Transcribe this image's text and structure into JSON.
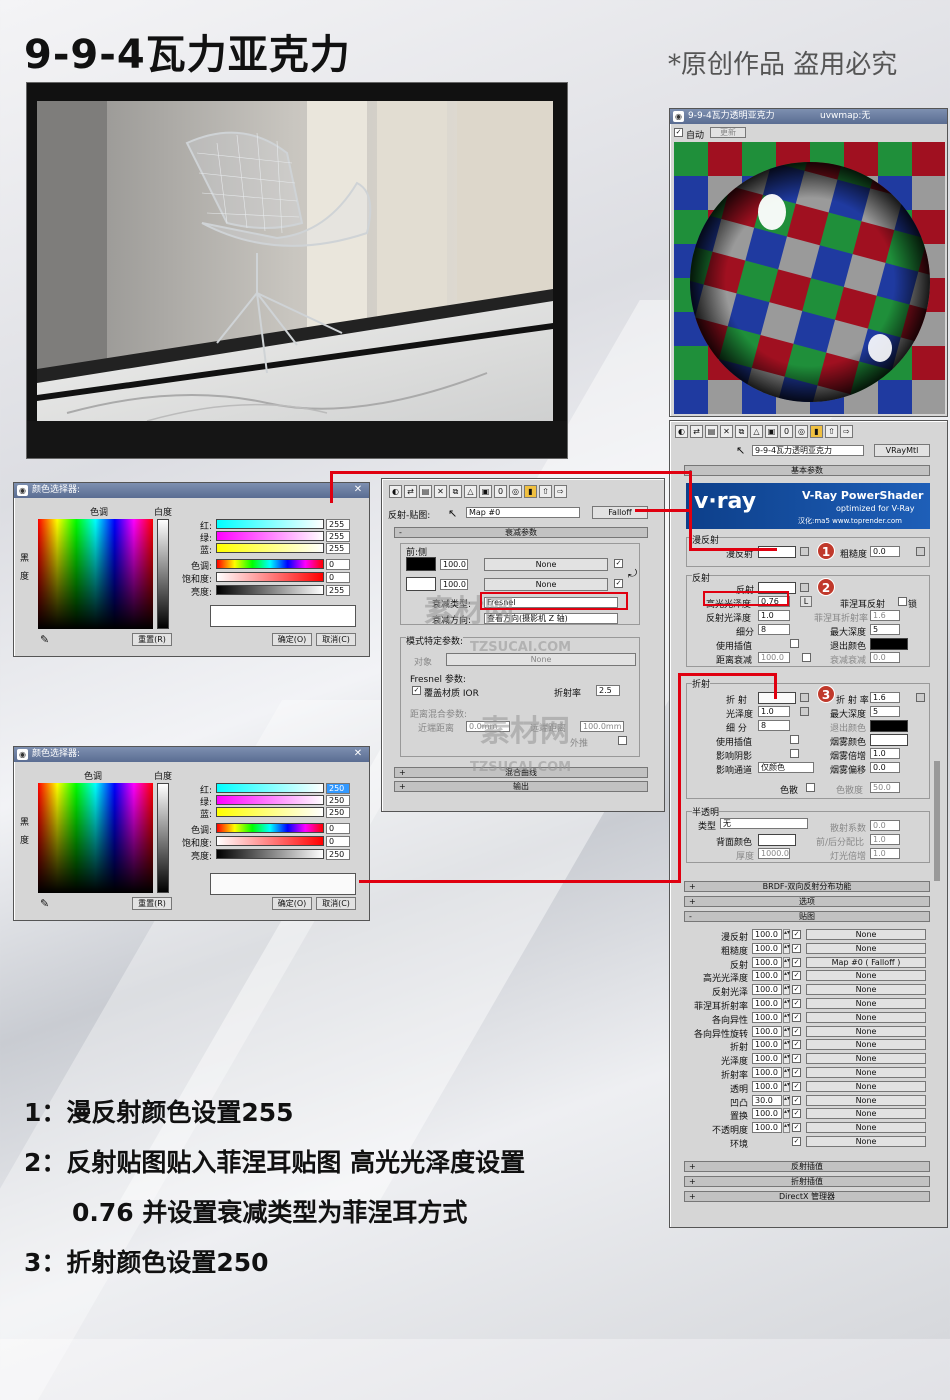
{
  "title": "9-9-4瓦力亚克力",
  "copyright": "*原创作品 盗用必究",
  "watermark": {
    "line1": "素材网",
    "line2": "TZSUCAI.COM"
  },
  "colorpicker1": {
    "title": "颜色选择器:",
    "hue": "色调",
    "white": "白度",
    "black": "黑",
    "degree": "度",
    "labels": [
      "红:",
      "绿:",
      "蓝:",
      "色调:",
      "饱和度:",
      "亮度:"
    ],
    "values": [
      "255",
      "255",
      "255",
      "0",
      "0",
      "255"
    ],
    "reset": "重置(R)",
    "ok": "确定(O)",
    "cancel": "取消(C)"
  },
  "colorpicker2": {
    "title": "颜色选择器:",
    "hue": "色调",
    "white": "白度",
    "black": "黑",
    "degree": "度",
    "labels": [
      "红:",
      "绿:",
      "蓝:",
      "色调:",
      "饱和度:",
      "亮度:"
    ],
    "values": [
      "250",
      "250",
      "250",
      "0",
      "0",
      "250"
    ],
    "reset": "重置(R)",
    "ok": "确定(O)",
    "cancel": "取消(C)"
  },
  "falloff": {
    "map_label": "反射-贴图:",
    "map_name": "Map #0",
    "map_type": "Falloff",
    "rollout": "衰减参数",
    "front_side": "前:侧",
    "v1": "100.0",
    "v2": "100.0",
    "none": "None",
    "falloff_type_label": "衰减类型:",
    "falloff_type": "Fresnel",
    "falloff_dir_label": "衰减方向:",
    "falloff_dir": "查看方向(摄影机 Z 轴)",
    "mode_params": "模式特定参数:",
    "object": "对象",
    "object_none": "None",
    "fresnel_params": "Fresnel 参数:",
    "override_ior": "覆盖材质 IOR",
    "ior_label": "折射率",
    "ior": "2.5",
    "dist_blend": "距离混合参数:",
    "near_label": "近端距离",
    "near": "0.0mm",
    "far_label": "远端距离",
    "far": "100.0mm",
    "extrapolate": "外推",
    "mix_curve": "混合曲线",
    "output": "输出"
  },
  "material": {
    "title": "9-9-4瓦力透明亚克力",
    "title2": "uvwmap:无",
    "auto": "自动",
    "update": "更新",
    "mat_name": "9-9-4瓦力透明亚克力",
    "mat_type": "VRayMtl",
    "basic_params": "基本参数",
    "vray_logo": "v·ray",
    "banner_title": "V-Ray PowerShader",
    "banner_sub": "optimized for V-Ray",
    "banner_credit": "汉化:ma5  www.toprender.com",
    "diffuse_grp": "漫反射",
    "diffuse": "漫反射",
    "roughness": "粗糙度",
    "roughness_val": "0.0",
    "reflect_grp": "反射",
    "reflect": "反射",
    "hilight": "高光光泽度",
    "hilight_val": "0.76",
    "lock": "L",
    "fresnel": "菲涅耳反射",
    "lock2": "锁",
    "refl_gloss": "反射光泽度",
    "refl_gloss_val": "1.0",
    "fresnel_ior": "菲涅耳折射率",
    "fresnel_ior_val": "1.6",
    "subdivs": "细分",
    "subdivs_val": "8",
    "max_depth": "最大深度",
    "max_depth_val": "5",
    "interp": "使用插值",
    "exit_color": "退出颜色",
    "dim_dist": "距离衰减",
    "dim_dist_val": "100.0",
    "dim_falloff": "衰减衰减",
    "dim_falloff_val": "0.0",
    "refract_grp": "折射",
    "refract": "折  射",
    "ior": "折 射 率",
    "ior_val": "1.6",
    "gloss": "光泽度",
    "gloss_val": "1.0",
    "max_depth2_val": "5",
    "subdivs2": "细  分",
    "subdivs2_val": "8",
    "exit_color2": "退出颜色",
    "interp2": "使用插值",
    "fog_color": "烟雾颜色",
    "shadows": "影响阴影",
    "fog_mult": "烟雾倍增",
    "fog_mult_val": "1.0",
    "affect_ch": "影响通道",
    "affect_ch_val": "仅颜色",
    "fog_bias": "烟雾偏移",
    "fog_bias_val": "0.0",
    "dispersion": "色散",
    "abbe": "色散度",
    "abbe_val": "50.0",
    "translucent_grp": "半透明",
    "type": "类型",
    "type_val": "无",
    "scatter": "散射系数",
    "scatter_val": "0.0",
    "back_color": "背面颜色",
    "fb": "前/后分配比",
    "fb_val": "1.0",
    "thickness": "厚度",
    "thickness_val": "1000.0",
    "light_mult": "灯光倍增",
    "light_mult_val": "1.0",
    "brdf": "BRDF-双向反射分布功能",
    "options": "选项",
    "maps": "贴图",
    "refl_interp": "反射插值",
    "refr_interp": "折射插值",
    "directx": "DirectX 管理器",
    "map_rows": [
      {
        "name": "漫反射",
        "val": "100.0",
        "map": "None"
      },
      {
        "name": "粗糙度",
        "val": "100.0",
        "map": "None"
      },
      {
        "name": "反射",
        "val": "100.0",
        "map": "Map #0  ( Falloff )"
      },
      {
        "name": "高光光泽度",
        "val": "100.0",
        "map": "None"
      },
      {
        "name": "反射光泽",
        "val": "100.0",
        "map": "None"
      },
      {
        "name": "菲涅耳折射率",
        "val": "100.0",
        "map": "None"
      },
      {
        "name": "各向异性",
        "val": "100.0",
        "map": "None"
      },
      {
        "name": "各向异性旋转",
        "val": "100.0",
        "map": "None"
      },
      {
        "name": "折射",
        "val": "100.0",
        "map": "None"
      },
      {
        "name": "光泽度",
        "val": "100.0",
        "map": "None"
      },
      {
        "name": "折射率",
        "val": "100.0",
        "map": "None"
      },
      {
        "name": "透明",
        "val": "100.0",
        "map": "None"
      },
      {
        "name": "凹凸",
        "val": "30.0",
        "map": "None"
      },
      {
        "name": "置换",
        "val": "100.0",
        "map": "None"
      },
      {
        "name": "不透明度",
        "val": "100.0",
        "map": "None"
      },
      {
        "name": "环境",
        "val": "",
        "map": "None"
      }
    ]
  },
  "notes": [
    "1：漫反射颜色设置255",
    "2：反射贴图贴入菲涅耳贴图  高光光泽度设置",
    "0.76 并设置衰减类型为菲涅耳方式",
    "3：折射颜色设置250"
  ],
  "marks": [
    "1",
    "2",
    "3"
  ],
  "colors": {
    "accent": "#e00010",
    "titlebar": "#6a7ca0"
  }
}
